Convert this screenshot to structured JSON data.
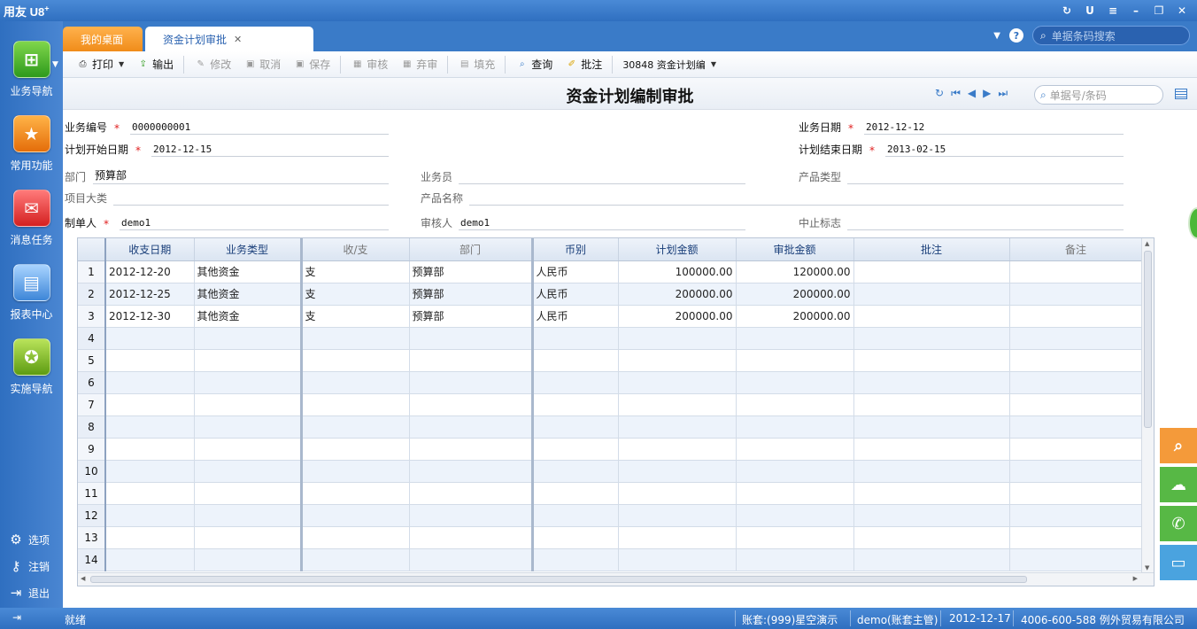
{
  "app": {
    "logo": "用友",
    "logo_mark": "U8",
    "logo_sup": "+"
  },
  "sidebar": {
    "items": [
      {
        "label": "业务导航",
        "icon": "business-nav-icon"
      },
      {
        "label": "常用功能",
        "icon": "star-icon"
      },
      {
        "label": "消息任务",
        "icon": "message-icon"
      },
      {
        "label": "报表中心",
        "icon": "report-icon"
      },
      {
        "label": "实施导航",
        "icon": "compass-icon"
      }
    ],
    "tools": [
      {
        "label": "选项",
        "icon": "gear-icon"
      },
      {
        "label": "注销",
        "icon": "key-icon"
      },
      {
        "label": "退出",
        "icon": "exit-icon"
      }
    ]
  },
  "tabs": {
    "home": "我的桌面",
    "active": "资金计划审批"
  },
  "top_search": {
    "placeholder": "单据条码搜索"
  },
  "toolbar": {
    "print": "打印",
    "export": "输出",
    "edit": "修改",
    "cancel": "取消",
    "save": "保存",
    "audit": "审核",
    "unaudit": "弃审",
    "fill": "填充",
    "query": "查询",
    "approve": "批注",
    "template": "30848 资金计划编"
  },
  "form": {
    "title": "资金计划编制审批",
    "bill_search_placeholder": "单据号/条码",
    "fields": {
      "biz_no_label": "业务编号",
      "biz_no": "0000000001",
      "biz_date_label": "业务日期",
      "biz_date": "2012-12-12",
      "plan_start_label": "计划开始日期",
      "plan_start": "2012-12-15",
      "plan_end_label": "计划结束日期",
      "plan_end": "2013-02-15",
      "dept_label": "部门",
      "dept": "预算部",
      "salesman_label": "业务员",
      "salesman": "",
      "product_type_label": "产品类型",
      "product_type": "",
      "project_class_label": "项目大类",
      "project_class": "",
      "product_name_label": "产品名称",
      "product_name": "",
      "maker_label": "制单人",
      "maker": "demo1",
      "auditor_label": "审核人",
      "auditor": "demo1",
      "stop_flag_label": "中止标志",
      "stop_flag": ""
    },
    "required_mark": "*"
  },
  "table": {
    "columns": [
      "",
      "收支日期",
      "业务类型",
      "收/支",
      "部门",
      "币别",
      "计划金额",
      "审批金额",
      "批注",
      "备注"
    ],
    "rows": [
      [
        "1",
        "2012-12-20",
        "其他资金",
        "支",
        "预算部",
        "人民币",
        "100000.00",
        "120000.00",
        "",
        ""
      ],
      [
        "2",
        "2012-12-25",
        "其他资金",
        "支",
        "预算部",
        "人民币",
        "200000.00",
        "200000.00",
        "",
        ""
      ],
      [
        "3",
        "2012-12-30",
        "其他资金",
        "支",
        "预算部",
        "人民币",
        "200000.00",
        "200000.00",
        "",
        ""
      ],
      [
        "4",
        "",
        "",
        "",
        "",
        "",
        "",
        "",
        "",
        ""
      ],
      [
        "5",
        "",
        "",
        "",
        "",
        "",
        "",
        "",
        "",
        ""
      ],
      [
        "6",
        "",
        "",
        "",
        "",
        "",
        "",
        "",
        "",
        ""
      ],
      [
        "7",
        "",
        "",
        "",
        "",
        "",
        "",
        "",
        "",
        ""
      ],
      [
        "8",
        "",
        "",
        "",
        "",
        "",
        "",
        "",
        "",
        ""
      ],
      [
        "9",
        "",
        "",
        "",
        "",
        "",
        "",
        "",
        "",
        ""
      ],
      [
        "10",
        "",
        "",
        "",
        "",
        "",
        "",
        "",
        "",
        ""
      ],
      [
        "11",
        "",
        "",
        "",
        "",
        "",
        "",
        "",
        "",
        ""
      ],
      [
        "12",
        "",
        "",
        "",
        "",
        "",
        "",
        "",
        "",
        ""
      ],
      [
        "13",
        "",
        "",
        "",
        "",
        "",
        "",
        "",
        "",
        ""
      ],
      [
        "14",
        "",
        "",
        "",
        "",
        "",
        "",
        "",
        "",
        ""
      ]
    ]
  },
  "status": {
    "ready": "就绪",
    "account": "账套:(999)星空演示",
    "user": "demo(账套主管)",
    "date": "2012-12-17",
    "company": "4006-600-588 例外贸易有限公司"
  },
  "colors": {
    "brand_blue": "#3a7bc8",
    "tab_orange": "#f08c1a",
    "required_red": "#e02020"
  }
}
